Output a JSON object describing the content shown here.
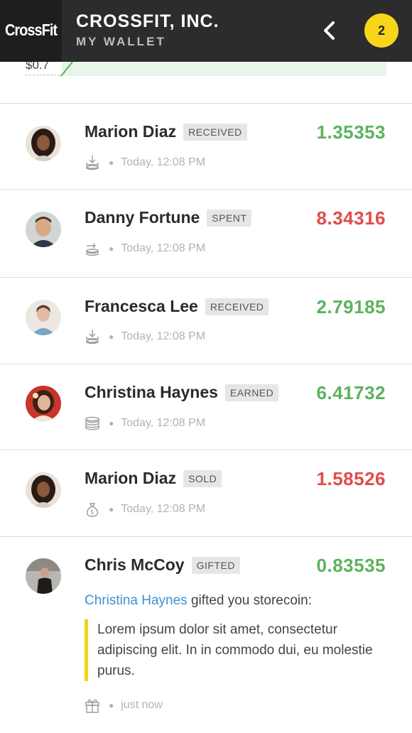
{
  "header": {
    "logo": "CrossFit",
    "title": "CROSSFIT, INC.",
    "subtitle": "MY WALLET",
    "notification_count": "2"
  },
  "chart_fragment": {
    "label": "$0.7"
  },
  "colors": {
    "positive": "#5bb35e",
    "negative": "#e24b48",
    "accent": "#f7d51b",
    "link": "#3f8fd2"
  },
  "transactions": [
    {
      "name": "Marion Diaz",
      "tag": "RECEIVED",
      "amount": "1.35353",
      "sign": "positive",
      "icon": "download-coins-icon",
      "time": "Today, 12:08 PM"
    },
    {
      "name": "Danny Fortune",
      "tag": "SPENT",
      "amount": "8.34316",
      "sign": "negative",
      "icon": "send-coins-icon",
      "time": "Today, 12:08 PM"
    },
    {
      "name": "Francesca Lee",
      "tag": "RECEIVED",
      "amount": "2.79185",
      "sign": "positive",
      "icon": "download-coins-icon",
      "time": "Today, 12:08 PM"
    },
    {
      "name": "Christina Haynes",
      "tag": "EARNED",
      "amount": "6.41732",
      "sign": "positive",
      "icon": "coin-stack-icon",
      "time": "Today, 12:08 PM"
    },
    {
      "name": "Marion Diaz",
      "tag": "SOLD",
      "amount": "1.58526",
      "sign": "negative",
      "icon": "money-bag-icon",
      "time": "Today, 12:08 PM"
    },
    {
      "name": "Chris McCoy",
      "tag": "GIFTED",
      "amount": "0.83535",
      "sign": "positive",
      "icon": "gift-icon",
      "time": "just now",
      "gift_from": "Christina Haynes",
      "gift_text": " gifted you storecoin:",
      "message": "Lorem ipsum dolor sit amet, consectetur adipiscing elit. In in commodo dui, eu molestie purus."
    }
  ]
}
